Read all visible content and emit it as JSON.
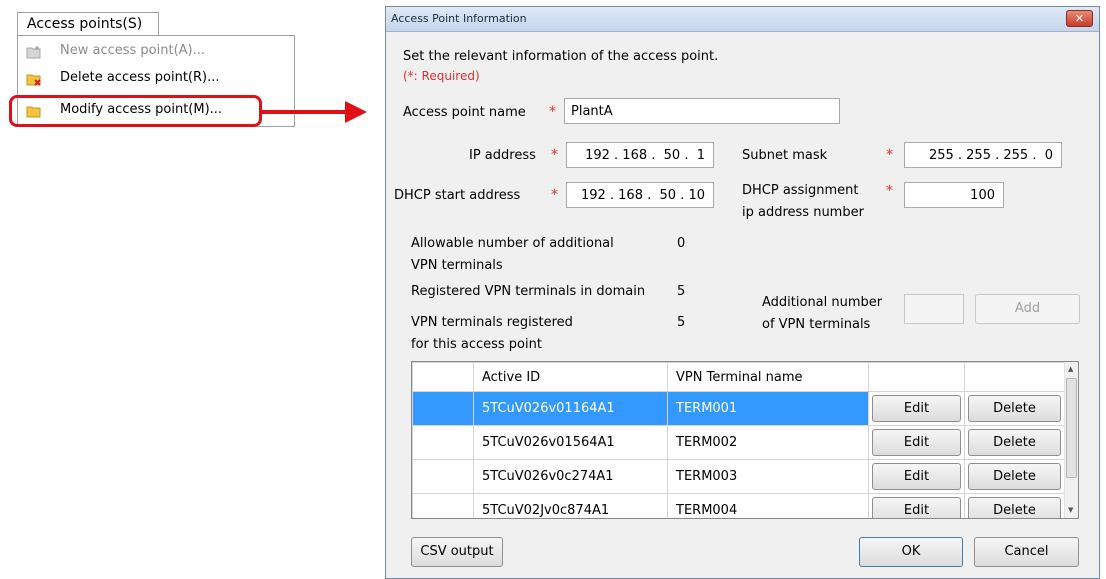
{
  "menu": {
    "tab_label": "Access points(S)",
    "items": [
      {
        "label": "New access point(A)...",
        "icon": "new-folder-icon",
        "enabled": false
      },
      {
        "label": "Delete access point(R)...",
        "icon": "delete-folder-icon",
        "enabled": true
      },
      {
        "label": "Modify access point(M)...",
        "icon": "folder-icon",
        "enabled": true
      }
    ],
    "highlight_color": "#e0101a"
  },
  "dialog": {
    "title": "Access Point Information",
    "close_label": "✕",
    "description": "Set the relevant information of the access point.",
    "required_note": "(*: Required)",
    "required_mark": "*",
    "fields": {
      "access_point_name": {
        "label": "Access point name",
        "value": "PlantA"
      },
      "ip_address": {
        "label": "IP address",
        "value": "192 . 168 .  50 .  1"
      },
      "subnet_mask": {
        "label": "Subnet mask",
        "value": "255 . 255 . 255 .  0"
      },
      "dhcp_start": {
        "label": "DHCP start address",
        "value": "192 . 168 .  50 . 10"
      },
      "dhcp_count": {
        "label_line1": "DHCP assignment",
        "label_line2": "ip address number",
        "value": "100"
      }
    },
    "stats": {
      "allowable_label_1": "Allowable number of additional",
      "allowable_label_2": "VPN terminals",
      "allowable_value": "0",
      "registered_domain_label": "Registered VPN terminals in domain",
      "registered_domain_value": "5",
      "registered_ap_label_1": "VPN terminals registered",
      "registered_ap_label_2": "for this access point",
      "registered_ap_value": "5"
    },
    "additional": {
      "label_line1": "Additional number",
      "label_line2": "of VPN terminals",
      "value": "",
      "add_label": "Add"
    },
    "grid": {
      "headers": {
        "active_id": "Active ID",
        "terminal_name": "VPN Terminal name"
      },
      "edit_label": "Edit",
      "delete_label": "Delete",
      "rows": [
        {
          "active_id": "5TCuV026v01164A1",
          "terminal_name": "TERM001",
          "selected": true
        },
        {
          "active_id": "5TCuV026v01564A1",
          "terminal_name": "TERM002",
          "selected": false
        },
        {
          "active_id": "5TCuV026v0c274A1",
          "terminal_name": "TERM003",
          "selected": false
        },
        {
          "active_id": "5TCuV02Jv0c874A1",
          "terminal_name": "TERM004",
          "selected": false
        }
      ],
      "selection_color": "#3399ff"
    },
    "buttons": {
      "csv_output": "CSV output",
      "ok": "OK",
      "cancel": "Cancel"
    }
  }
}
